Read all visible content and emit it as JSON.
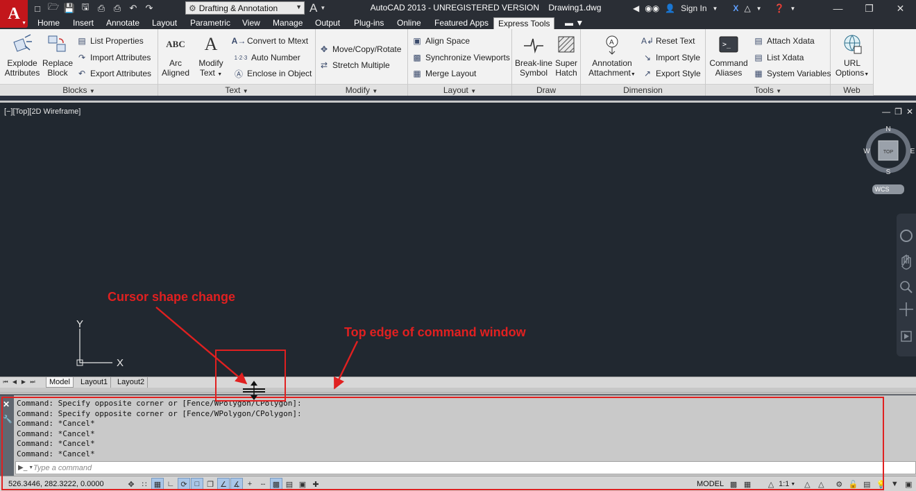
{
  "window": {
    "title": "AutoCAD 2013 - UNREGISTERED VERSION",
    "document": "Drawing1.dwg",
    "workspace": "Drafting & Annotation",
    "sign_in": "Sign In"
  },
  "app_menu": {
    "letter": "A"
  },
  "ribbon_tabs": [
    {
      "label": "Home"
    },
    {
      "label": "Insert"
    },
    {
      "label": "Annotate"
    },
    {
      "label": "Layout"
    },
    {
      "label": "Parametric"
    },
    {
      "label": "View"
    },
    {
      "label": "Manage"
    },
    {
      "label": "Output"
    },
    {
      "label": "Plug-ins"
    },
    {
      "label": "Online"
    },
    {
      "label": "Featured Apps"
    },
    {
      "label": "Express Tools"
    }
  ],
  "ribbon": {
    "blocks": {
      "title": "Blocks",
      "explode_line1": "Explode",
      "explode_line2": "Attributes",
      "replace_line1": "Replace",
      "replace_line2": "Block",
      "list_properties": "List Properties",
      "import_attributes": "Import Attributes",
      "export_attributes": "Export Attributes"
    },
    "text": {
      "title": "Text",
      "arc_line1": "Arc",
      "arc_line2": "Aligned",
      "modify_line1": "Modify",
      "modify_line2": "Text",
      "convert_to_mtext": "Convert to Mtext",
      "auto_number": "Auto Number",
      "enclose_in_object": "Enclose in Object",
      "arc_icon_text": "ABC",
      "auto_number_icon_text": "1·2·3"
    },
    "modify": {
      "title": "Modify",
      "move_copy_rotate": "Move/Copy/Rotate",
      "stretch_multiple": "Stretch Multiple"
    },
    "layout": {
      "title": "Layout",
      "align_space": "Align Space",
      "synchronize_viewports": "Synchronize Viewports",
      "merge_layout": "Merge Layout"
    },
    "draw": {
      "title": "Draw",
      "breakline_line1": "Break-line",
      "breakline_line2": "Symbol",
      "superhatch_line1": "Super",
      "superhatch_line2": "Hatch"
    },
    "dimension": {
      "title": "Dimension",
      "annotation_line1": "Annotation",
      "annotation_line2": "Attachment",
      "reset_text": "Reset Text",
      "import_style": "Import Style",
      "export_style": "Export Style"
    },
    "tools": {
      "title": "Tools",
      "command_line1": "Command",
      "command_line2": "Aliases",
      "attach_xdata": "Attach Xdata",
      "list_xdata": "List Xdata",
      "system_variables": "System Variables"
    },
    "web": {
      "title": "Web",
      "url_line1": "URL",
      "url_line2": "Options"
    }
  },
  "viewport": {
    "label": "[−][Top][2D Wireframe]",
    "viewcube": {
      "n": "N",
      "s": "S",
      "e": "E",
      "w": "W",
      "top": "TOP",
      "wcs": "WCS"
    },
    "ucs": {
      "x": "X",
      "y": "Y"
    }
  },
  "annotations": {
    "cursor_label": "Cursor shape change",
    "edge_label": "Top edge of command window"
  },
  "layout_tabs": [
    {
      "label": "Model"
    },
    {
      "label": "Layout1"
    },
    {
      "label": "Layout2"
    }
  ],
  "command_window": {
    "history": [
      "Command: Specify opposite corner or [Fence/WPolygon/CPolygon]:",
      "Command: Specify opposite corner or [Fence/WPolygon/CPolygon]:",
      "Command: *Cancel*",
      "Command: *Cancel*",
      "Command: *Cancel*",
      "Command: *Cancel*"
    ],
    "input_placeholder": "Type a command",
    "input_value": ""
  },
  "status_bar": {
    "coordinates": "526.3446, 282.3222, 0.0000",
    "model": "MODEL",
    "scale": "1:1"
  },
  "colors": {
    "title_bg": "#2a2e35",
    "ribbon_bg": "#f2f2f2",
    "drawing_bg": "#212830",
    "annotation_red": "#e02020",
    "command_bg": "#c9c9c9"
  }
}
